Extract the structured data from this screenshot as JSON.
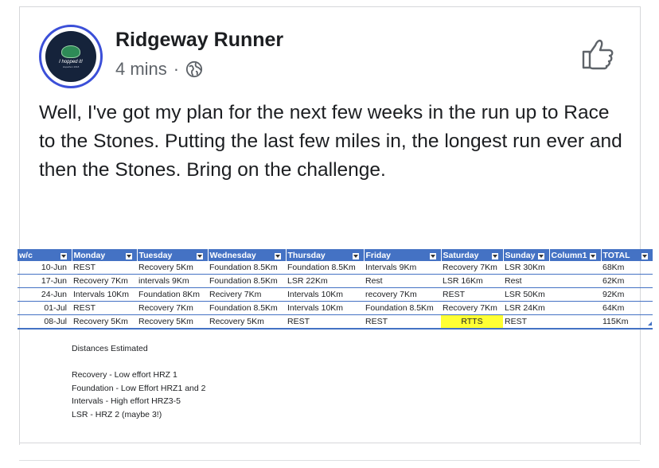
{
  "post": {
    "author": "Ridgeway Runner",
    "time": "4 mins",
    "separator": "·",
    "privacy_icon": "globe-icon",
    "like_icon": "thumbs-up-icon",
    "text": "Well, I've got my plan for the next few weeks in the run up to Race to the Stones.  Putting the last few miles in, the longest run ever and then the Stones.  Bring on the challenge.",
    "avatar": {
      "caption": "I hopped it!",
      "subcaption": "Hopathon 2018"
    }
  },
  "sheet": {
    "headers": [
      "w/c",
      "Monday",
      "Tuesday",
      "Wednesday",
      "Thursday",
      "Friday",
      "Saturday",
      "Sunday",
      "Column1",
      "TOTAL"
    ],
    "rows": [
      [
        "10-Jun",
        "REST",
        "Recovery 5Km",
        "Foundation 8.5Km",
        "Foundation 8.5Km",
        "Intervals 9Km",
        "Recovery 7Km",
        "LSR 30Km",
        "",
        "68Km"
      ],
      [
        "17-Jun",
        "Recovery 7Km",
        "intervals 9Km",
        "Foundation 8.5Km",
        "LSR 22Km",
        "Rest",
        "LSR 16Km",
        "Rest",
        "",
        "62Km"
      ],
      [
        "24-Jun",
        "Intervals 10Km",
        "Foundation 8Km",
        "Recivery 7Km",
        "Intervals 10Km",
        "recovery 7Km",
        "REST",
        "LSR 50Km",
        "",
        "92Km"
      ],
      [
        "01-Jul",
        "REST",
        "Recovery 7Km",
        "Foundation 8.5Km",
        "Intervals 10Km",
        "Foundation 8.5Km",
        "Recovery 7Km",
        "LSR 24Km",
        "",
        "64Km"
      ],
      [
        "08-Jul",
        "Recovery 5Km",
        "Recovery 5Km",
        "Recovery 5Km",
        "REST",
        "REST",
        "RTTS",
        "REST",
        "",
        "115Km"
      ]
    ],
    "highlight_color": "#ffff33",
    "header_color": "#4472c4",
    "notes": [
      "Distances Estimated",
      "",
      "Recovery - Low effort HRZ 1",
      "Foundation - Low Effort HRZ1 and 2",
      "Intervals - High effort HRZ3-5",
      "LSR - HRZ 2 (maybe 3!)"
    ]
  }
}
